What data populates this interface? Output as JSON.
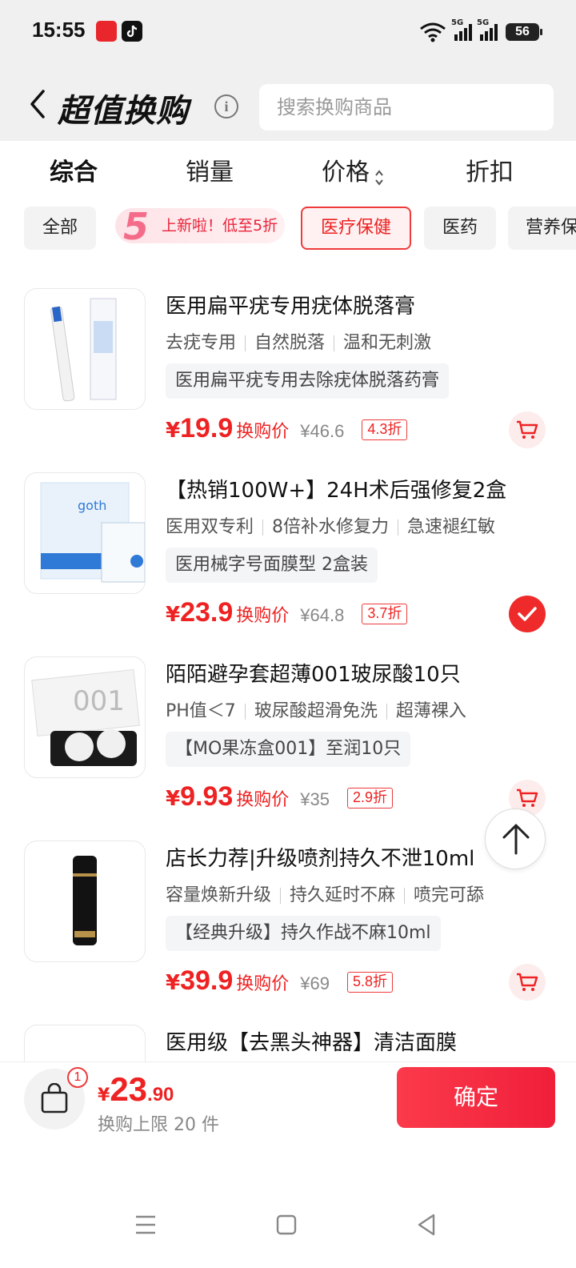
{
  "status": {
    "time": "15:55",
    "battery": "56",
    "net1": "5G",
    "net2": "5G"
  },
  "header": {
    "title": "超值换购",
    "info_icon": "info-icon",
    "search_placeholder": "搜索换购商品"
  },
  "sort_tabs": [
    {
      "label": "综合",
      "active": true
    },
    {
      "label": "销量",
      "active": false
    },
    {
      "label": "价格",
      "active": false
    },
    {
      "label": "折扣",
      "active": false
    }
  ],
  "chips": {
    "all": "全部",
    "promo_badge": "5",
    "promo_text": "上新啦！低至5折",
    "medical": "医疗保健",
    "medicine": "医药",
    "nutrition": "营养保"
  },
  "products": [
    {
      "title": "医用扁平疣专用疣体脱落膏",
      "tags": [
        "去疣专用",
        "自然脱落",
        "温和无刺激"
      ],
      "spec": "医用扁平疣专用去除疣体脱落药膏",
      "yen": "¥",
      "price": "19.9",
      "price_label": "换购价",
      "original": "¥46.6",
      "discount": "4.3折",
      "selected": false
    },
    {
      "title": "【热销100W+】24H术后强修复2盒",
      "tags": [
        "医用双专利",
        "8倍补水修复力",
        "急速褪红敏"
      ],
      "spec": "医用械字号面膜型 2盒装",
      "yen": "¥",
      "price": "23.9",
      "price_label": "换购价",
      "original": "¥64.8",
      "discount": "3.7折",
      "selected": true
    },
    {
      "title": "陌陌避孕套超薄001玻尿酸10只",
      "tags": [
        "PH值＜7",
        "玻尿酸超滑免洗",
        "超薄裸入"
      ],
      "spec": "【MO果冻盒001】至润10只",
      "yen": "¥",
      "price": "9.93",
      "price_label": "换购价",
      "original": "¥35",
      "discount": "2.9折",
      "selected": false
    },
    {
      "title": "店长力荐|升级喷剂持久不泄10ml",
      "tags": [
        "容量焕新升级",
        "持久延时不麻",
        "喷完可舔"
      ],
      "spec": "【经典升级】持久作战不麻10ml",
      "yen": "¥",
      "price": "39.9",
      "price_label": "换购价",
      "original": "¥69",
      "discount": "5.8折",
      "selected": false
    },
    {
      "title": "医用级【去黑头神器】清洁面膜"
    }
  ],
  "footer": {
    "bag_count": "1",
    "yen": "¥",
    "total_int": "23",
    "total_dec": ".90",
    "limit": "换购上限 20 件",
    "confirm": "确定"
  },
  "colors": {
    "accent": "#ee2222",
    "header_bg": "#f0f0f0",
    "chip_bg": "#f3f3f3"
  }
}
